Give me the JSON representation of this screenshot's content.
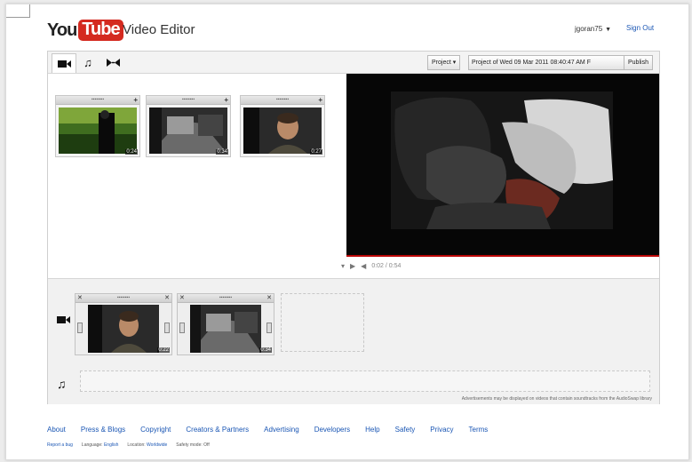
{
  "header": {
    "logo_you": "You",
    "logo_tube": "Tube",
    "app_title": "Video Editor",
    "username": "jgoran75",
    "sign_out": "Sign Out"
  },
  "toolbar": {
    "tabs": [
      {
        "name": "video",
        "icon": "video-camera-icon",
        "glyph": "■"
      },
      {
        "name": "audio",
        "icon": "music-note-icon",
        "glyph": "♫"
      },
      {
        "name": "transitions",
        "icon": "transition-icon",
        "glyph": "▸◂"
      }
    ],
    "project_menu": "Project ▾",
    "project_name": "Project of Wed 09 Mar 2011 08:40:47 AM F",
    "publish": "Publish"
  },
  "library": {
    "clips": [
      {
        "duration": "0:24",
        "grip": "▪▪▪▪▪▪▪▪",
        "add": "+"
      },
      {
        "duration": "0:34",
        "grip": "▪▪▪▪▪▪▪▪",
        "add": "+"
      },
      {
        "duration": "0:27",
        "grip": "▪▪▪▪▪▪▪▪",
        "add": "+"
      }
    ]
  },
  "player": {
    "time": "0:02 / 0:54"
  },
  "timeline": {
    "clips": [
      {
        "duration": "0:22",
        "grip": "▪▪▪▪▪▪▪▪",
        "close": "✕"
      },
      {
        "duration": "0:34",
        "grip": "▪▪▪▪▪▪▪▪",
        "close": "✕"
      }
    ],
    "ad_note": "Advertisements may be displayed on videos that contain soundtracks from the AudioSwap library"
  },
  "footer": {
    "links": [
      "About",
      "Press & Blogs",
      "Copyright",
      "Creators & Partners",
      "Advertising",
      "Developers",
      "Help",
      "Safety",
      "Privacy",
      "Terms"
    ],
    "report_bug": "Report a bug",
    "language_label": "Language:",
    "language_value": "English",
    "location_label": "Location:",
    "location_value": "Worldwide",
    "safety_label": "Safety mode:",
    "safety_value": "Off"
  },
  "colors": {
    "brand_red": "#d42a20",
    "link_blue": "#1a56b4",
    "progress_red": "#b80000"
  }
}
